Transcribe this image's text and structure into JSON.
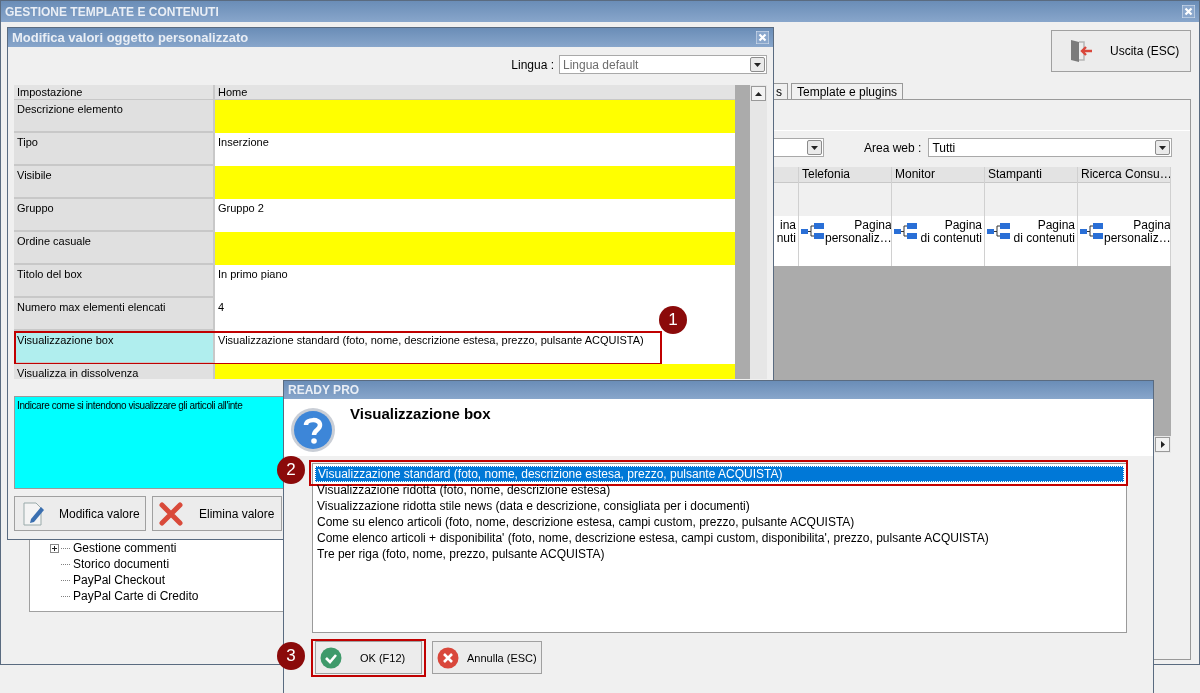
{
  "main_window": {
    "title": "GESTIONE TEMPLATE E CONTENUTI",
    "exit_button": "Uscita (ESC)",
    "tabs": [
      {
        "label": "s",
        "selected": false
      },
      {
        "label": "Template e plugins",
        "selected": false
      }
    ],
    "area_label": "Area web :",
    "area_value": "Tutti",
    "grid": {
      "columns": [
        {
          "lines": [
            "ina",
            "nuti"
          ]
        },
        {
          "header": "Telefonia",
          "lines": [
            "Pagina",
            "personaliz…"
          ]
        },
        {
          "header": "Monitor",
          "lines": [
            "Pagina",
            "di contenuti"
          ]
        },
        {
          "header": "Stampanti",
          "lines": [
            "Pagina",
            "di contenuti"
          ]
        },
        {
          "header": "Ricerca Consu…",
          "lines": [
            "Pagina",
            "personaliz…"
          ]
        }
      ]
    },
    "tree": [
      {
        "label": "Gestione commenti",
        "expandable": true
      },
      {
        "label": "Storico documenti",
        "expandable": false
      },
      {
        "label": "PayPal Checkout",
        "expandable": false
      },
      {
        "label": "PayPal Carte di Credito",
        "expandable": false
      }
    ]
  },
  "edit_dialog": {
    "title": "Modifica valori oggetto personalizzato",
    "language_label": "Lingua :",
    "language_value": "Lingua default",
    "columns": [
      "Impostazione",
      "Home"
    ],
    "rows": [
      {
        "label": "Descrizione elemento",
        "flagged": true,
        "selected": false
      },
      {
        "label": "Tipo",
        "value": "Inserzione",
        "flagged": false,
        "selected": false
      },
      {
        "label": "Visibile",
        "flagged": true,
        "selected": false
      },
      {
        "label": "Gruppo",
        "value": "Gruppo 2",
        "flagged": false,
        "selected": false
      },
      {
        "label": "Ordine casuale",
        "flagged": true,
        "selected": false
      },
      {
        "label": "Titolo del box",
        "value": "In primo piano",
        "flagged": false,
        "selected": false
      },
      {
        "label": "Numero max elementi elencati",
        "value": "4",
        "flagged": false,
        "selected": false
      },
      {
        "label": "Visualizzazione box",
        "value": "Visualizzazione standard (foto, nome, descrizione estesa, prezzo, pulsante ACQUISTA)",
        "flagged": false,
        "selected": true,
        "callout": "1"
      },
      {
        "label": "Visualizza in dissolvenza",
        "flagged": true,
        "selected": false
      }
    ],
    "description": "Indicare come si intendono visualizzare gli articoli all'inte",
    "buttons": [
      {
        "kind": "edit",
        "label": "Modifica valore"
      },
      {
        "kind": "delete",
        "label": "Elimina valore"
      }
    ]
  },
  "choice_dialog": {
    "title": "READY PRO",
    "heading": "Visualizzazione box",
    "options": [
      {
        "label": "Visualizzazione standard (foto, nome, descrizione estesa, prezzo, pulsante ACQUISTA)",
        "selected": true,
        "callout": "2"
      },
      {
        "label": "Visualizzazione ridotta (foto, nome, descrizione estesa)",
        "selected": false
      },
      {
        "label": "Visualizzazione ridotta stile news (data e descrizione, consigliata per i documenti)",
        "selected": false
      },
      {
        "label": "Come su elenco articoli (foto, nome, descrizione estesa, campi custom, prezzo, pulsante ACQUISTA)",
        "selected": false
      },
      {
        "label": "Come elenco articoli + disponibilita' (foto, nome, descrizione estesa, campi custom, disponibilita', prezzo, pulsante ACQUISTA)",
        "selected": false
      },
      {
        "label": "Tre per riga (foto, nome, prezzo, pulsante ACQUISTA)",
        "selected": false
      }
    ],
    "buttons": [
      {
        "kind": "ok",
        "label": "OK (F12)",
        "callout": "3"
      },
      {
        "kind": "cancel",
        "label": "Annulla (ESC)"
      }
    ]
  }
}
